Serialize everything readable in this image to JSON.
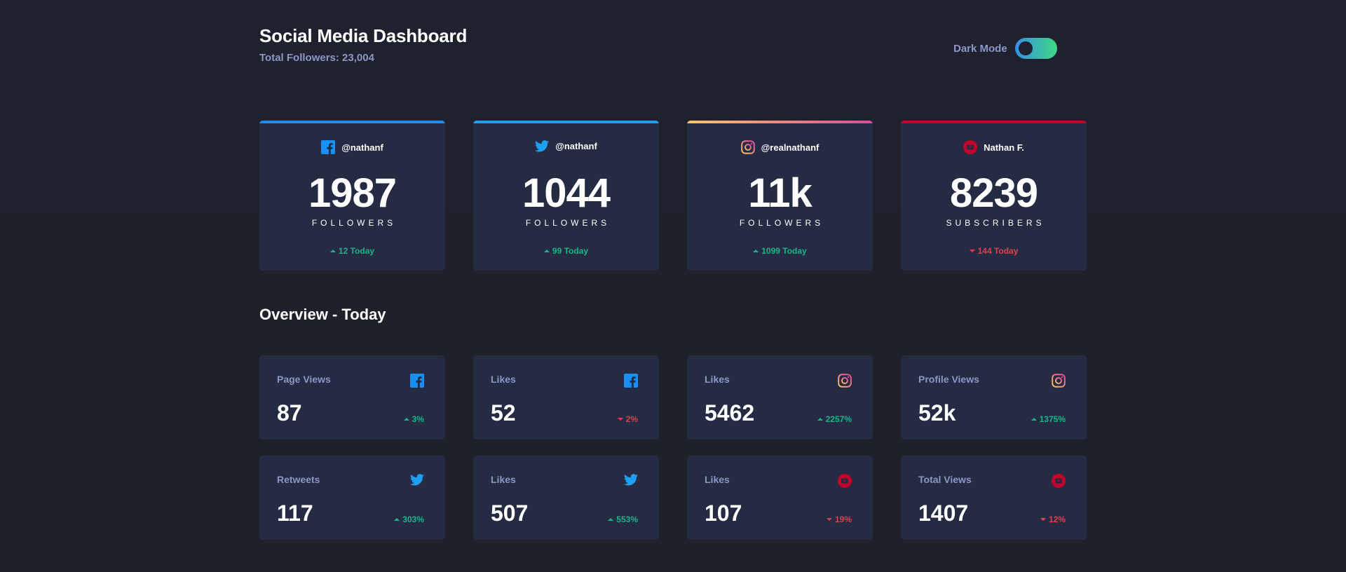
{
  "header": {
    "title": "Social Media Dashboard",
    "subtitle": "Total Followers: 23,004",
    "toggle_label": "Dark Mode",
    "toggle_on": true
  },
  "colors": {
    "background": "#1e202a",
    "card": "#252b43",
    "muted_text": "#8b97c6",
    "up": "#1db489",
    "down": "#dc414c",
    "facebook": "#198ff5",
    "twitter": "#1ca0f2",
    "instagram_gradient": [
      "#fdc468",
      "#df4996"
    ],
    "youtube": "#c4032a",
    "toggle_gradient": [
      "#378fe6",
      "#3eda82"
    ]
  },
  "followers": [
    {
      "network": "facebook",
      "icon": "facebook-icon",
      "handle": "@nathanf",
      "count": "1987",
      "unit": "FOLLOWERS",
      "change": "12 Today",
      "trend": "up"
    },
    {
      "network": "twitter",
      "icon": "twitter-icon",
      "handle": "@nathanf",
      "count": "1044",
      "unit": "FOLLOWERS",
      "change": "99 Today",
      "trend": "up"
    },
    {
      "network": "instagram",
      "icon": "instagram-icon",
      "handle": "@realnathanf",
      "count": "11k",
      "unit": "FOLLOWERS",
      "change": "1099 Today",
      "trend": "up"
    },
    {
      "network": "youtube",
      "icon": "youtube-icon",
      "handle": "Nathan F.",
      "count": "8239",
      "unit": "SUBSCRIBERS",
      "change": "144 Today",
      "trend": "down"
    }
  ],
  "overview": {
    "title": "Overview - Today",
    "items": [
      {
        "label": "Page Views",
        "network": "facebook",
        "icon": "facebook-icon",
        "value": "87",
        "change": "3%",
        "trend": "up"
      },
      {
        "label": "Likes",
        "network": "facebook",
        "icon": "facebook-icon",
        "value": "52",
        "change": "2%",
        "trend": "down"
      },
      {
        "label": "Likes",
        "network": "instagram",
        "icon": "instagram-icon",
        "value": "5462",
        "change": "2257%",
        "trend": "up"
      },
      {
        "label": "Profile Views",
        "network": "instagram",
        "icon": "instagram-icon",
        "value": "52k",
        "change": "1375%",
        "trend": "up"
      },
      {
        "label": "Retweets",
        "network": "twitter",
        "icon": "twitter-icon",
        "value": "117",
        "change": "303%",
        "trend": "up"
      },
      {
        "label": "Likes",
        "network": "twitter",
        "icon": "twitter-icon",
        "value": "507",
        "change": "553%",
        "trend": "up"
      },
      {
        "label": "Likes",
        "network": "youtube",
        "icon": "youtube-icon",
        "value": "107",
        "change": "19%",
        "trend": "down"
      },
      {
        "label": "Total Views",
        "network": "youtube",
        "icon": "youtube-icon",
        "value": "1407",
        "change": "12%",
        "trend": "down"
      }
    ]
  }
}
